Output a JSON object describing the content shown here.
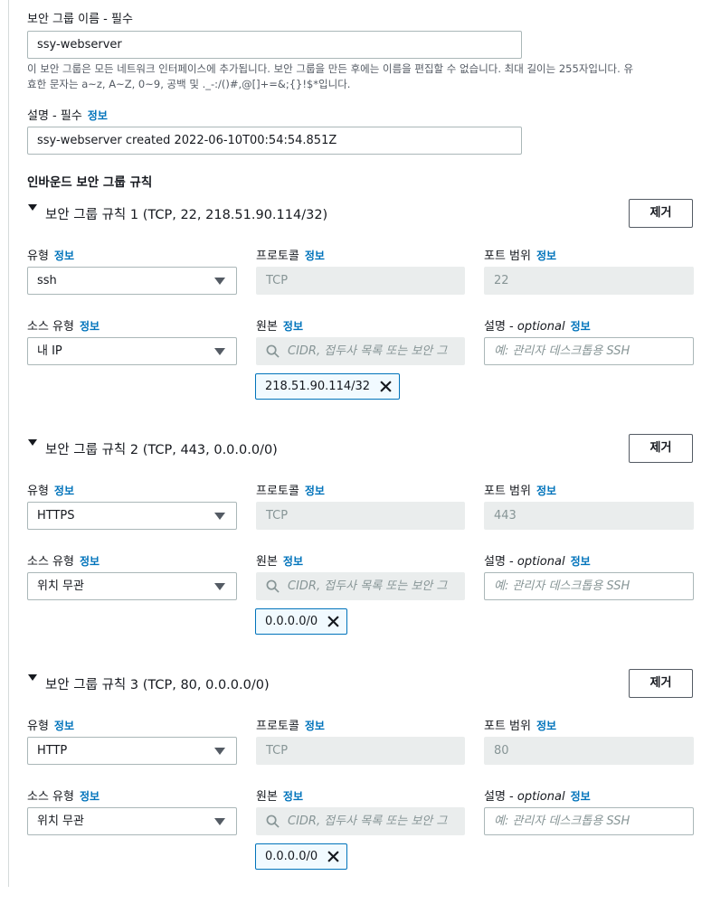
{
  "name_field": {
    "label": "보안 그룹 이름 - 필수",
    "value": "ssy-webserver",
    "hint_line1": "이 보안 그룹은 모든 네트워크 인터페이스에 추가됩니다. 보안 그룹을 만든 후에는 이름을 편집할 수 없습니다. 최대 길이는 255자입니다. 유",
    "hint_line2": "효한 문자는 a~z, A~Z, 0~9, 공백 및 ._-:/()#,@[]+=&;{}!$*입니다."
  },
  "description_field": {
    "label": "설명 - 필수",
    "info_link": "정보",
    "value": "ssy-webserver created 2022-06-10T00:54:54.851Z"
  },
  "inbound": {
    "title": "인바운드 보안 그룹 규칙",
    "rules": [
      {
        "header": "보안 그룹 규칙 1 (TCP, 22, 218.51.90.114/32)",
        "remove_label": "제거",
        "type_label": "유형",
        "type_info": "정보",
        "type_value": "ssh",
        "protocol_label": "프로토콜",
        "protocol_info": "정보",
        "protocol_value": "TCP",
        "port_label": "포트 범위",
        "port_info": "정보",
        "port_value": "22",
        "source_type_label": "소스 유형",
        "source_type_info": "정보",
        "source_type_value": "내 IP",
        "source_label": "원본",
        "source_info": "정보",
        "source_placeholder": "CIDR, 접두사 목록 또는 보안 그",
        "desc_label": "설명",
        "desc_optional": "optional",
        "desc_info": "정보",
        "desc_placeholder": "예: 관리자 데스크톱용 SSH",
        "token": "218.51.90.114/32"
      },
      {
        "header": "보안 그룹 규칙 2 (TCP, 443, 0.0.0.0/0)",
        "remove_label": "제거",
        "type_label": "유형",
        "type_info": "정보",
        "type_value": "HTTPS",
        "protocol_label": "프로토콜",
        "protocol_info": "정보",
        "protocol_value": "TCP",
        "port_label": "포트 범위",
        "port_info": "정보",
        "port_value": "443",
        "source_type_label": "소스 유형",
        "source_type_info": "정보",
        "source_type_value": "위치 무관",
        "source_label": "원본",
        "source_info": "정보",
        "source_placeholder": "CIDR, 접두사 목록 또는 보안 그",
        "desc_label": "설명",
        "desc_optional": "optional",
        "desc_info": "정보",
        "desc_placeholder": "예: 관리자 데스크톱용 SSH",
        "token": "0.0.0.0/0"
      },
      {
        "header": "보안 그룹 규칙 3 (TCP, 80, 0.0.0.0/0)",
        "remove_label": "제거",
        "type_label": "유형",
        "type_info": "정보",
        "type_value": "HTTP",
        "protocol_label": "프로토콜",
        "protocol_info": "정보",
        "protocol_value": "TCP",
        "port_label": "포트 범위",
        "port_info": "정보",
        "port_value": "80",
        "source_type_label": "소스 유형",
        "source_type_info": "정보",
        "source_type_value": "위치 무관",
        "source_label": "원본",
        "source_info": "정보",
        "source_placeholder": "CIDR, 접두사 목록 또는 보안 그",
        "desc_label": "설명",
        "desc_optional": "optional",
        "desc_info": "정보",
        "desc_placeholder": "예: 관리자 데스크톱용 SSH",
        "token": "0.0.0.0/0"
      }
    ]
  }
}
